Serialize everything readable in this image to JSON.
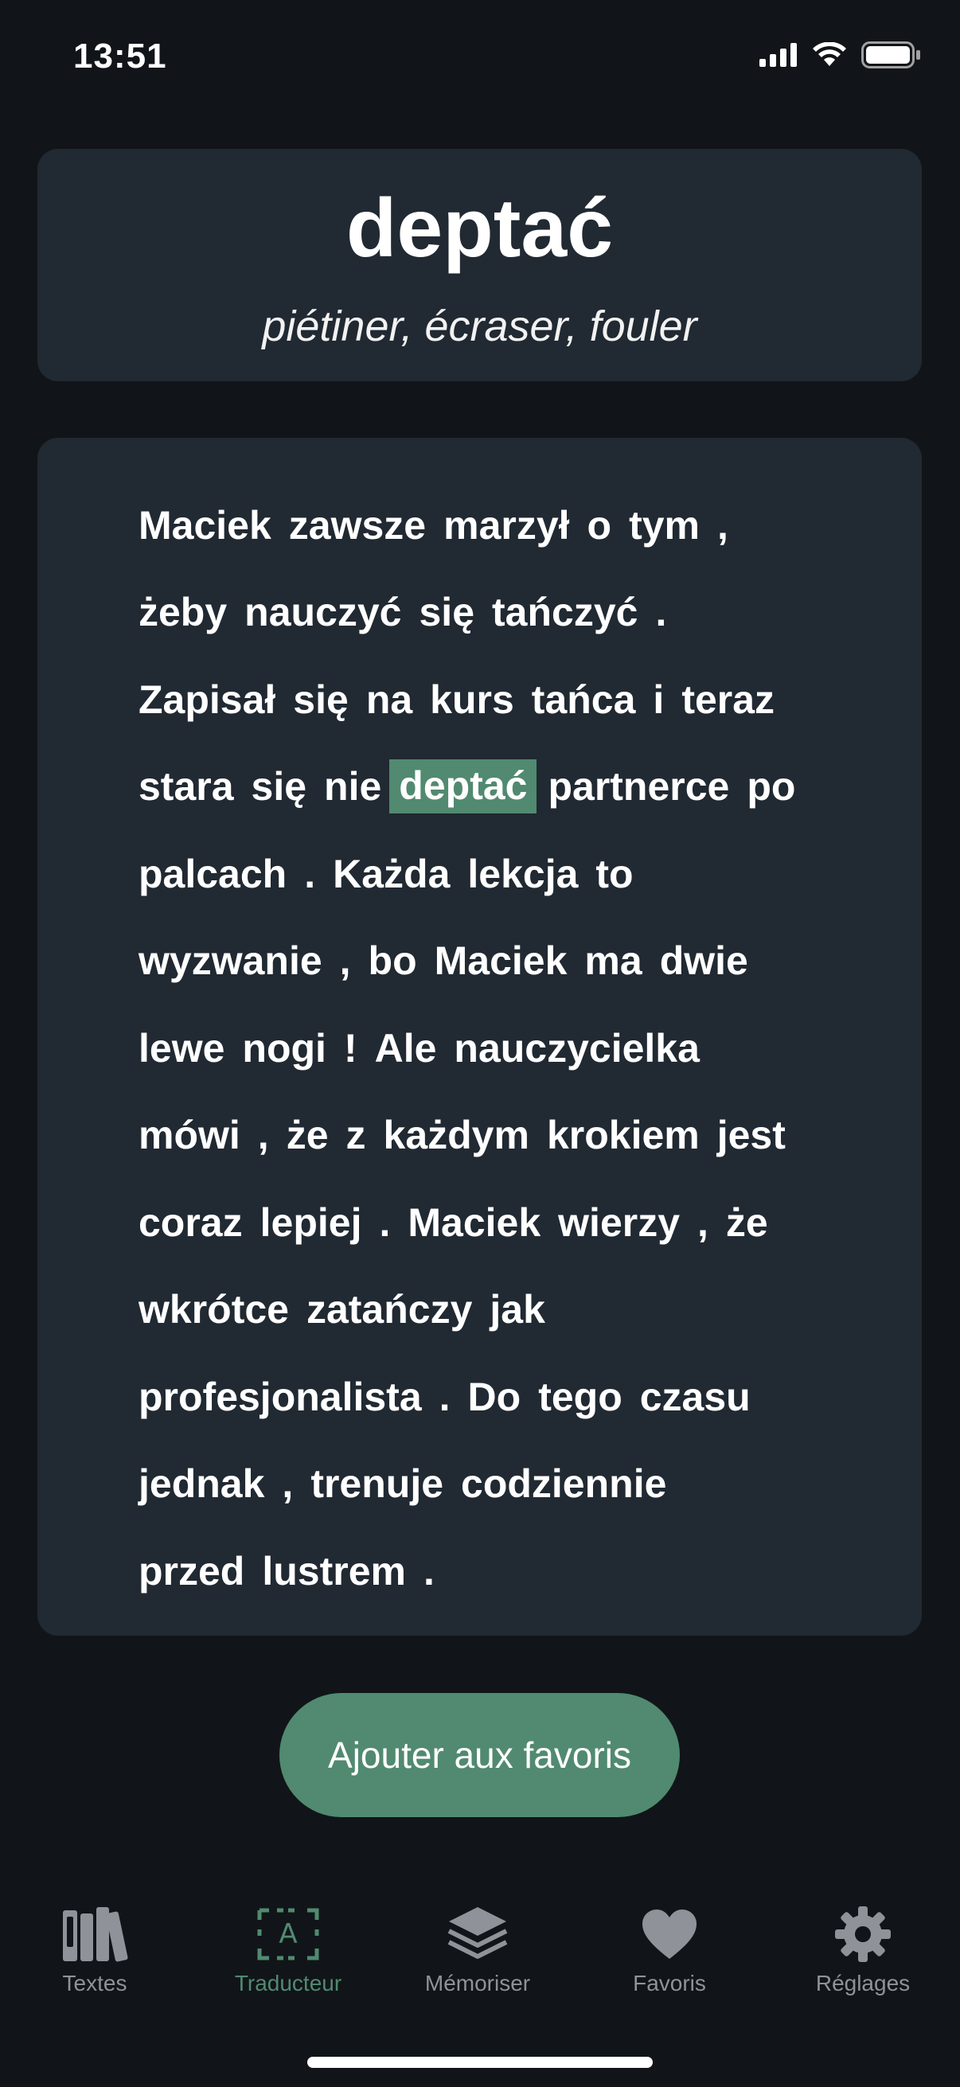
{
  "status_bar": {
    "time": "13:51",
    "icons": [
      "cellular-signal-icon",
      "wifi-icon",
      "battery-icon"
    ]
  },
  "word": {
    "title": "deptać",
    "translation": "piétiner, écraser, fouler"
  },
  "passage": {
    "highlight_word": "deptać",
    "highlight_color": "#518a70",
    "lines": [
      [
        "Maciek",
        "zawsze",
        "marzył",
        "o",
        "tym",
        ","
      ],
      [
        "żeby",
        "nauczyć",
        "się",
        "tańczyć",
        "."
      ],
      [
        "Zapisał",
        "się",
        "na",
        "kurs",
        "tańca",
        "i",
        "teraz"
      ],
      [
        "stara",
        "się",
        "nie",
        "deptać",
        "partnerce",
        "po"
      ],
      [
        "palcach",
        ".",
        "Każda",
        "lekcja",
        "to"
      ],
      [
        "wyzwanie",
        ",",
        "bo",
        "Maciek",
        "ma",
        "dwie"
      ],
      [
        "lewe",
        "nogi",
        "!",
        "Ale",
        "nauczycielka"
      ],
      [
        "mówi",
        ",",
        "że",
        "z",
        "każdym",
        "krokiem",
        "jest"
      ],
      [
        "coraz",
        "lepiej",
        ".",
        "Maciek",
        "wierzy",
        ",",
        "że"
      ],
      [
        "wkrótce",
        "zatańczy",
        "jak"
      ],
      [
        "profesjonalista",
        ".",
        "Do",
        "tego",
        "czasu"
      ],
      [
        "jednak",
        ",",
        "trenuje",
        "codziennie"
      ],
      [
        "przed",
        "lustrem",
        "."
      ]
    ]
  },
  "actions": {
    "favorite_label": "Ajouter aux favoris"
  },
  "tabs": [
    {
      "label": "Textes",
      "icon": "books-icon",
      "active": false
    },
    {
      "label": "Traducteur",
      "icon": "translate-icon",
      "active": true
    },
    {
      "label": "Mémoriser",
      "icon": "layers-icon",
      "active": false
    },
    {
      "label": "Favoris",
      "icon": "heart-icon",
      "active": false
    },
    {
      "label": "Réglages",
      "icon": "gear-icon",
      "active": false
    }
  ],
  "colors": {
    "background": "#111519",
    "card": "#212932",
    "accent": "#518a70",
    "inactive": "#8f9399"
  }
}
